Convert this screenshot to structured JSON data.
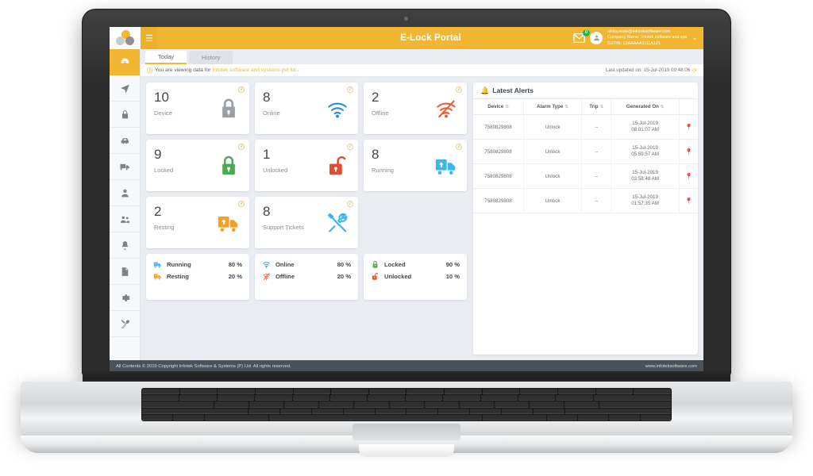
{
  "app": {
    "title": "E-Lock Portal",
    "logo_name": "infotek-logo",
    "menu_icon": "hamburger-icon"
  },
  "header": {
    "mail_badge": "0",
    "user_email": "nikita.mote@infoteksoftware.com",
    "company_line": "Company Name: Infotek software and sys",
    "gstin_line": "GSTIN: 12AAAAA1111A1Z1",
    "caret": "⌄"
  },
  "sidebar": {
    "items": [
      {
        "name": "dashboard",
        "icon": "dashboard-icon",
        "active": true
      },
      {
        "name": "tracking",
        "icon": "paper-plane-icon",
        "active": false
      },
      {
        "name": "locks",
        "icon": "lock-icon",
        "active": false
      },
      {
        "name": "vehicles",
        "icon": "car-icon",
        "active": false
      },
      {
        "name": "trucks",
        "icon": "truck-icon",
        "active": false
      },
      {
        "name": "user",
        "icon": "user-icon",
        "active": false
      },
      {
        "name": "groups",
        "icon": "users-icon",
        "active": false
      },
      {
        "name": "alerts",
        "icon": "bell-icon",
        "active": false
      },
      {
        "name": "reports",
        "icon": "document-icon",
        "active": false
      },
      {
        "name": "settings",
        "icon": "gear-icon",
        "active": false
      },
      {
        "name": "support",
        "icon": "tools-icon",
        "active": false
      }
    ]
  },
  "tabs": [
    {
      "label": "Today",
      "active": true
    },
    {
      "label": "History",
      "active": false
    }
  ],
  "infobar": {
    "icon": "info-icon",
    "prefix": "You are viewing data for",
    "org": "Infotek software and systems pvt ltd",
    "suffix": ".",
    "last_updated": "Last updated on: 15-Jul-2019 09:48:06",
    "refresh_icon": "refresh-icon"
  },
  "stats": [
    {
      "value": "10",
      "label": "Device",
      "icon": "lock-closed-gray-icon",
      "color": "#9aa0a6"
    },
    {
      "value": "8",
      "label": "Online",
      "icon": "wifi-icon",
      "color": "#2a8fd8"
    },
    {
      "value": "2",
      "label": "Offline",
      "icon": "wifi-off-icon",
      "color": "#e8603c"
    },
    {
      "value": "9",
      "label": "Locked",
      "icon": "lock-closed-green-icon",
      "color": "#4cab50"
    },
    {
      "value": "1",
      "label": "Unlocked",
      "icon": "lock-open-red-icon",
      "color": "#e04e2e"
    },
    {
      "value": "8",
      "label": "Running",
      "icon": "truck-blue-icon",
      "color": "#3bb7ef"
    },
    {
      "value": "2",
      "label": "Resting",
      "icon": "truck-orange-icon",
      "color": "#f2a127"
    },
    {
      "value": "8",
      "label": "Support Tickets",
      "icon": "tools-icon",
      "color": "#3bb7ef"
    }
  ],
  "info_dot_label": "i",
  "percent_cards": [
    {
      "rows": [
        {
          "icon": "truck-blue-icon",
          "name": "Running",
          "value": "80 %",
          "color": "#3bb7ef"
        },
        {
          "icon": "truck-orange-icon",
          "name": "Resting",
          "value": "20 %",
          "color": "#f2a127"
        }
      ]
    },
    {
      "rows": [
        {
          "icon": "wifi-icon",
          "name": "Online",
          "value": "80 %",
          "color": "#2a8fd8"
        },
        {
          "icon": "wifi-off-icon",
          "name": "Offline",
          "value": "20 %",
          "color": "#e8603c"
        }
      ]
    },
    {
      "rows": [
        {
          "icon": "lock-closed-green-icon",
          "name": "Locked",
          "value": "90 %",
          "color": "#4cab50"
        },
        {
          "icon": "lock-open-red-icon",
          "name": "Unlocked",
          "value": "10 %",
          "color": "#e04e2e"
        }
      ]
    }
  ],
  "alerts": {
    "title": "Latest Alerts",
    "bell_icon": "bell-icon",
    "columns": [
      "Device",
      "Alarm Type",
      "Trip",
      "Generated On",
      ""
    ],
    "rows": [
      {
        "device": "7580829808",
        "alarm_type": "Unlock",
        "trip": "--",
        "date": "15-Jul-2019",
        "time": "08:01:07 AM",
        "pin": "location-pin-icon"
      },
      {
        "device": "7580829808",
        "alarm_type": "Unlock",
        "trip": "--",
        "date": "15-Jul-2019",
        "time": "05:59:57 AM",
        "pin": "location-pin-icon"
      },
      {
        "device": "7580829808",
        "alarm_type": "Unlock",
        "trip": "--",
        "date": "15-Jul-2019",
        "time": "03:58:48 AM",
        "pin": "location-pin-icon"
      },
      {
        "device": "7580829808",
        "alarm_type": "Unlock",
        "trip": "--",
        "date": "15-Jul-2019",
        "time": "01:57:35 AM",
        "pin": "location-pin-icon"
      }
    ]
  },
  "footer": {
    "copyright": "All Contents © 2019 Copyright Infotek Software & Systems (P) Ltd. All rights reserved.",
    "website": "www.infoteksoftware.com"
  },
  "colors": {
    "brand_orange": "#F2B632",
    "content_bg": "#e9ecf0",
    "footer_bg": "#49525b",
    "badge_green": "#2cb24c"
  }
}
